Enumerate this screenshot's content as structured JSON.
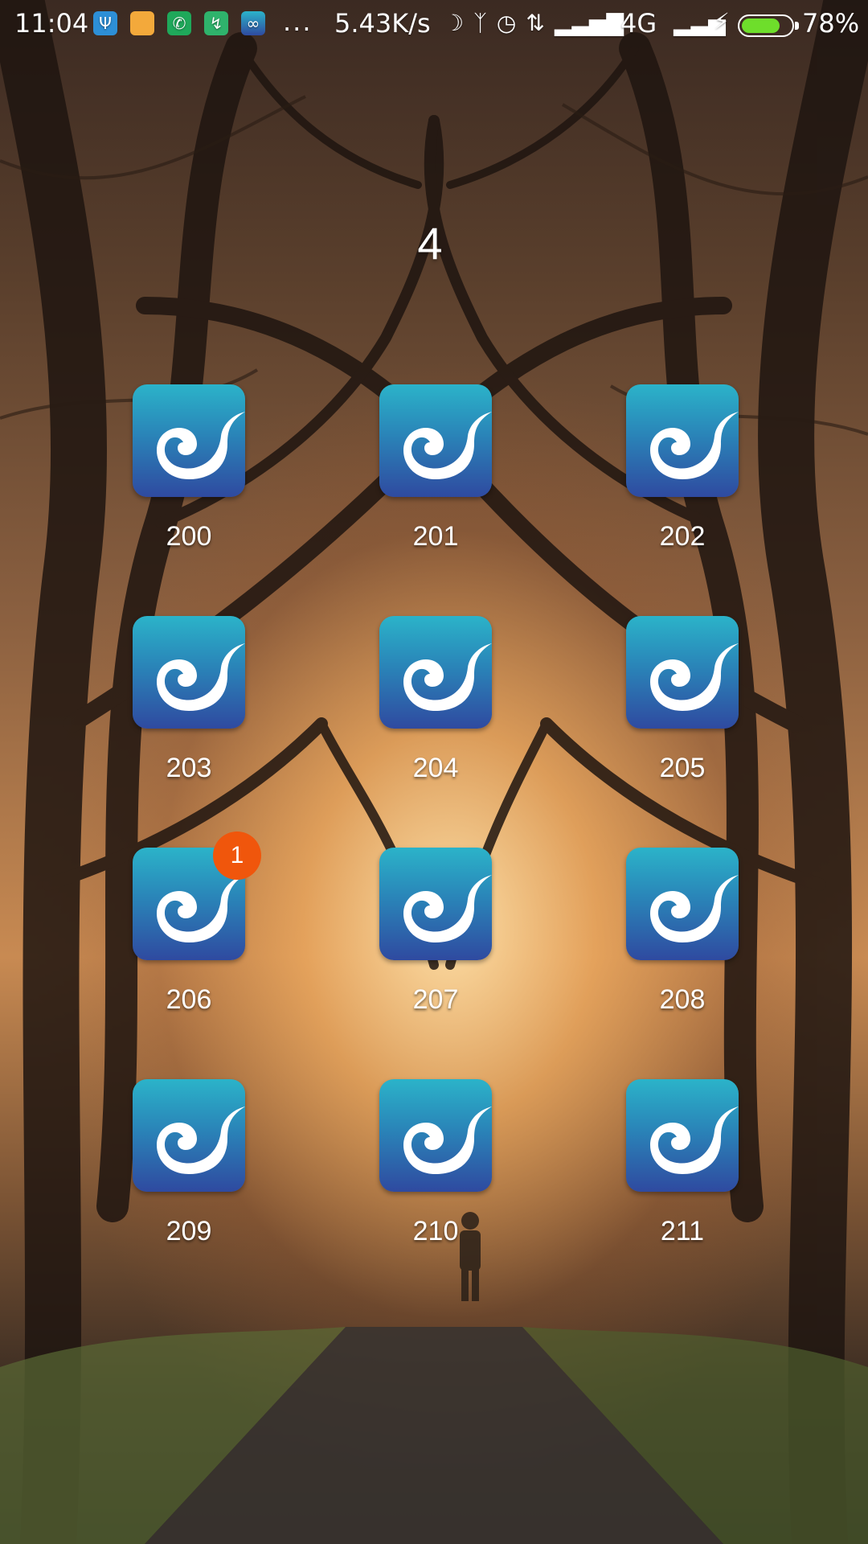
{
  "status_bar": {
    "time": "11:04",
    "more": "...",
    "net_speed": "5.43K/s",
    "network_type": "4G",
    "battery_percent": "78%",
    "battery_level": 0.78,
    "notification_icons": [
      "usb-icon",
      "message-icon",
      "phone-icon",
      "shield-icon",
      "app-icon"
    ],
    "status_icons": [
      "moon-icon",
      "bluetooth-icon",
      "alarm-icon",
      "data-arrows-icon",
      "signal-icon",
      "signal-icon",
      "bolt-icon"
    ]
  },
  "folder": {
    "title": "4",
    "apps": [
      {
        "label": "200",
        "badge": ""
      },
      {
        "label": "201",
        "badge": ""
      },
      {
        "label": "202",
        "badge": ""
      },
      {
        "label": "203",
        "badge": ""
      },
      {
        "label": "204",
        "badge": ""
      },
      {
        "label": "205",
        "badge": ""
      },
      {
        "label": "206",
        "badge": "1"
      },
      {
        "label": "207",
        "badge": ""
      },
      {
        "label": "208",
        "badge": ""
      },
      {
        "label": "209",
        "badge": ""
      },
      {
        "label": "210",
        "badge": ""
      },
      {
        "label": "211",
        "badge": ""
      }
    ]
  },
  "colors": {
    "icon_top": "#2bb3c9",
    "icon_bottom": "#2f4aa0",
    "badge": "#f0560c",
    "battery_fill": "#6ede2b"
  }
}
